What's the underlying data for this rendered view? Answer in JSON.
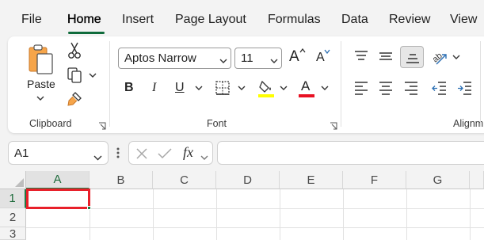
{
  "tabs": [
    "File",
    "Home",
    "Insert",
    "Page Layout",
    "Formulas",
    "Data",
    "Review",
    "View"
  ],
  "active_tab": "Home",
  "clipboard": {
    "paste_label": "Paste",
    "group_label": "Clipboard"
  },
  "font": {
    "font_name": "Aptos Narrow",
    "font_size": "11",
    "bold_label": "B",
    "italic_label": "I",
    "underline_label": "U",
    "font_color_letter": "A",
    "grow_label": "A",
    "shrink_label": "A",
    "group_label": "Font",
    "highlight_color": "#ffff00",
    "font_color": "#e81123"
  },
  "alignment": {
    "group_label": "Alignm"
  },
  "formula_bar": {
    "name_box": "A1",
    "fx_label": "fx",
    "formula_value": ""
  },
  "sheet": {
    "columns": [
      "A",
      "B",
      "C",
      "D",
      "E",
      "F",
      "G"
    ],
    "rows": [
      "1",
      "2",
      "3"
    ],
    "active_cell": "A1",
    "active_cell_border_color": "#e8202a",
    "accent_color": "#0f6b3b"
  }
}
